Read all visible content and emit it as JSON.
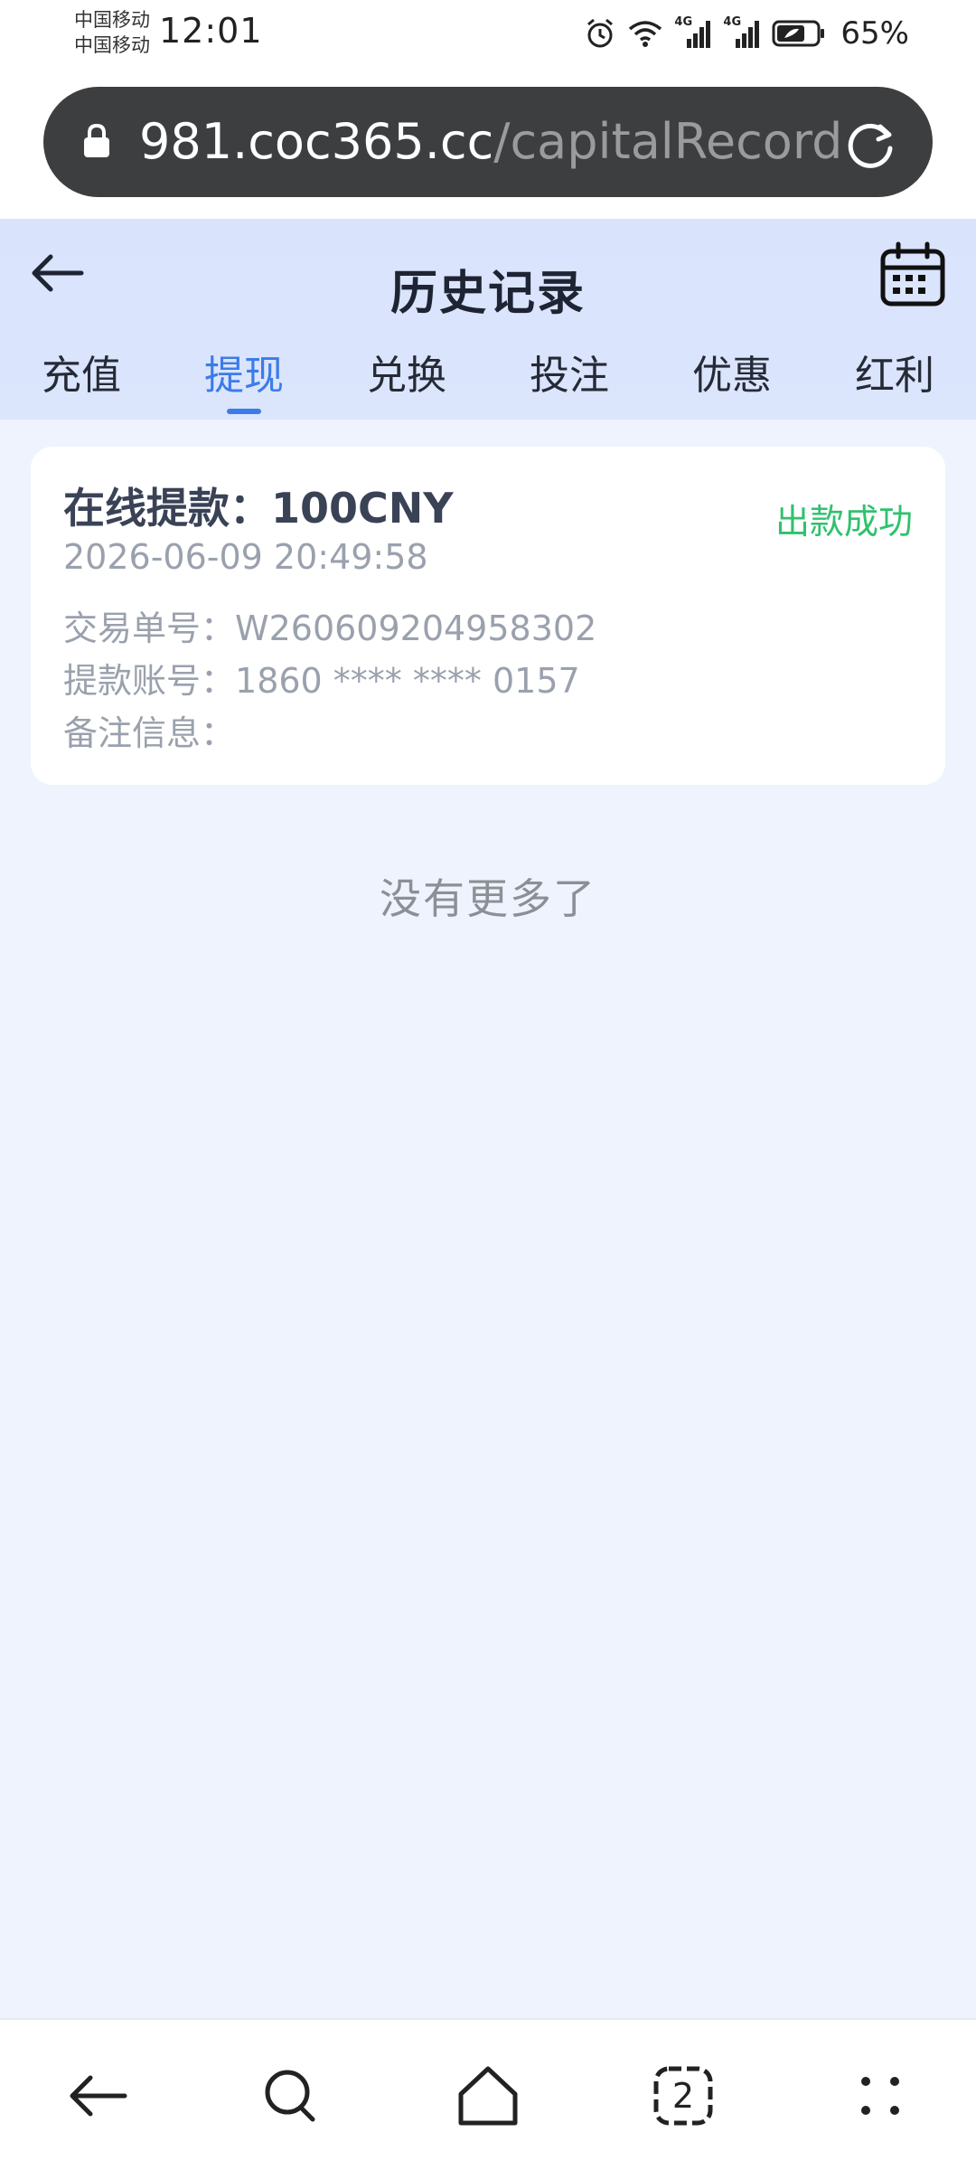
{
  "status_bar": {
    "carrier_1": "中国移动",
    "carrier_2": "中国移动",
    "time": "12:01",
    "network_1": "4G",
    "network_2": "4G",
    "battery": "65%"
  },
  "browser": {
    "url_host": "981.coc365.cc",
    "url_path": "/capitalRecord",
    "tab_count": "2"
  },
  "header": {
    "title": "历史记录"
  },
  "tabs": [
    {
      "label": "充值",
      "active": false
    },
    {
      "label": "提现",
      "active": true
    },
    {
      "label": "兑换",
      "active": false
    },
    {
      "label": "投注",
      "active": false
    },
    {
      "label": "优惠",
      "active": false
    },
    {
      "label": "红利",
      "active": false
    }
  ],
  "record": {
    "title": "在线提款：100CNY",
    "status": "出款成功",
    "time": "2026-06-09 20:49:58",
    "order_label": "交易单号：",
    "order_value": "W260609204958302",
    "account_label": "提款账号：",
    "account_value": "1860 **** **** 0157",
    "note_label": "备注信息：",
    "note_value": ""
  },
  "list_end_text": "没有更多了",
  "colors": {
    "accent": "#3c7be8",
    "success": "#2fc26e",
    "header_bg": "#d9e3fc",
    "page_bg": "#eef3fd"
  }
}
